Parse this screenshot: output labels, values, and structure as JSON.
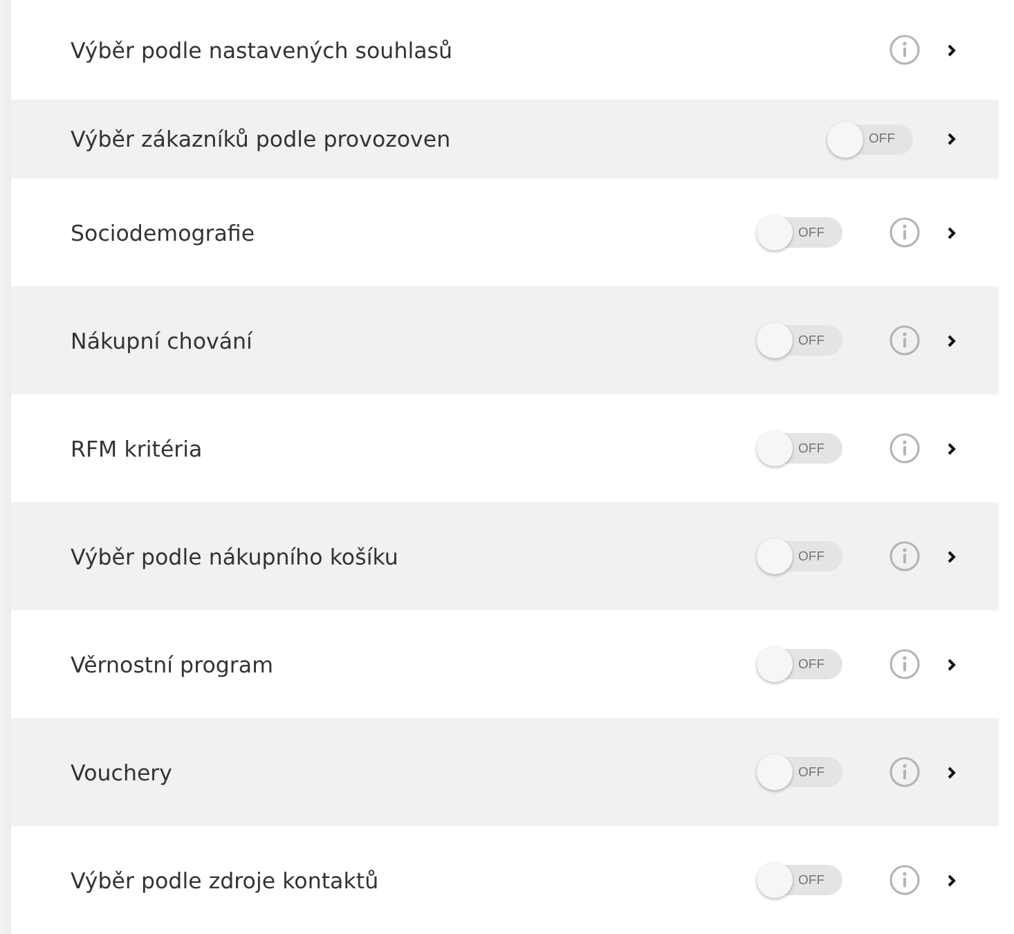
{
  "rows": [
    {
      "label": "Výběr podle nastavených souhlasů",
      "info": true
    },
    {
      "label": "Výběr zákazníků podle provozoven",
      "toggle": {
        "on": false,
        "text": "OFF"
      },
      "info": false
    },
    {
      "label": "Sociodemografie",
      "toggle": {
        "on": false,
        "text": "OFF"
      },
      "info": true
    },
    {
      "label": "Nákupní chování",
      "toggle": {
        "on": false,
        "text": "OFF"
      },
      "info": true
    },
    {
      "label": "RFM kritéria",
      "toggle": {
        "on": false,
        "text": "OFF"
      },
      "info": true
    },
    {
      "label": "Výběr podle nákupního košíku",
      "toggle": {
        "on": false,
        "text": "OFF"
      },
      "info": true
    },
    {
      "label": "Věrnostní program",
      "toggle": {
        "on": false,
        "text": "OFF"
      },
      "info": true
    },
    {
      "label": "Vouchery",
      "toggle": {
        "on": false,
        "text": "OFF"
      },
      "info": true
    },
    {
      "label": "Výběr podle zdroje kontaktů",
      "toggle": {
        "on": false,
        "text": "OFF"
      },
      "info": true
    }
  ]
}
